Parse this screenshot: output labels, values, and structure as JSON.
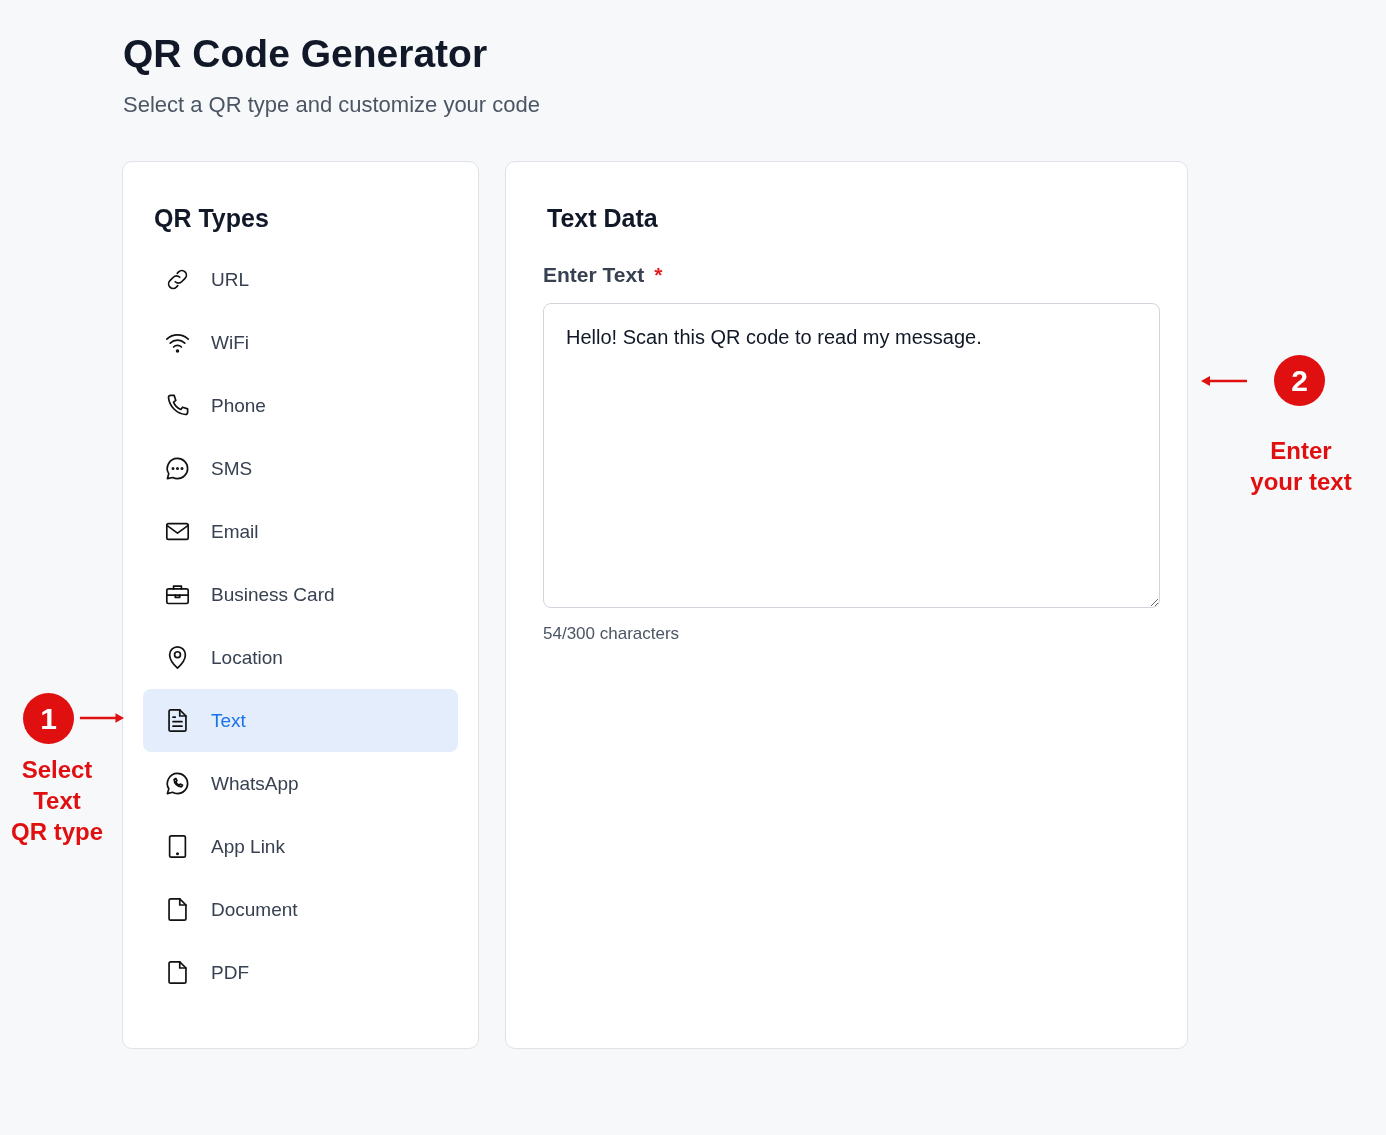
{
  "header": {
    "title": "QR Code Generator",
    "subtitle": "Select a QR type and customize your code"
  },
  "sidebar": {
    "title": "QR Types",
    "items": [
      {
        "label": "URL",
        "selected": false
      },
      {
        "label": "WiFi",
        "selected": false
      },
      {
        "label": "Phone",
        "selected": false
      },
      {
        "label": "SMS",
        "selected": false
      },
      {
        "label": "Email",
        "selected": false
      },
      {
        "label": "Business Card",
        "selected": false
      },
      {
        "label": "Location",
        "selected": false
      },
      {
        "label": "Text",
        "selected": true
      },
      {
        "label": "WhatsApp",
        "selected": false
      },
      {
        "label": "App Link",
        "selected": false
      },
      {
        "label": "Document",
        "selected": false
      },
      {
        "label": "PDF",
        "selected": false
      }
    ]
  },
  "panel": {
    "title": "Text Data",
    "field": {
      "label": "Enter Text",
      "required_mark": "*",
      "value": "Hello! Scan this QR code to read my message.",
      "counter": "54/300 characters"
    }
  },
  "annotations": [
    {
      "number": "1",
      "lines": [
        "Select",
        "Text",
        "QR type"
      ]
    },
    {
      "number": "2",
      "lines": [
        "Enter",
        "your text"
      ]
    }
  ]
}
